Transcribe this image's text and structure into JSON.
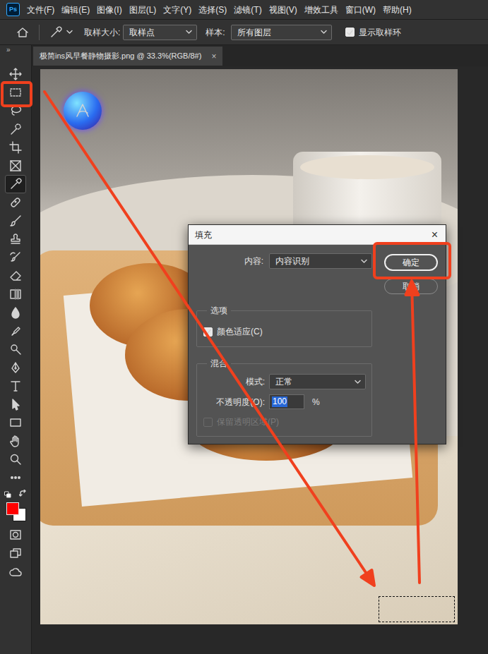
{
  "app": {
    "logo": "Ps"
  },
  "menu": [
    "文件(F)",
    "编辑(E)",
    "图像(I)",
    "图层(L)",
    "文字(Y)",
    "选择(S)",
    "滤镜(T)",
    "视图(V)",
    "增效工具",
    "窗口(W)",
    "帮助(H)"
  ],
  "options_bar": {
    "sample_size_label": "取样大小:",
    "sample_size_value": "取样点",
    "sample_label": "样本:",
    "sample_value": "所有图层",
    "show_ring": {
      "label": "显示取样环",
      "checked": true
    }
  },
  "toolbar": {
    "collapse": "»",
    "tools": [
      {
        "selected": false
      },
      {
        "selected": false
      },
      {
        "selected": false
      },
      {
        "selected": false
      },
      {
        "selected": false
      },
      {
        "selected": false
      },
      {
        "selected": true
      },
      {
        "selected": false
      },
      {
        "selected": false
      },
      {
        "selected": false
      },
      {
        "selected": false
      },
      {
        "selected": false
      },
      {
        "selected": false
      },
      {
        "selected": false
      },
      {
        "selected": false
      },
      {
        "selected": false
      },
      {
        "selected": false
      },
      {
        "selected": false
      },
      {
        "selected": false
      },
      {
        "selected": false
      },
      {
        "selected": false
      },
      {
        "selected": false
      },
      {
        "selected": false
      },
      {
        "selected": false
      },
      {
        "selected": false
      },
      {
        "selected": false
      }
    ],
    "colors": {
      "foreground": "#ff0000",
      "background": "#ffffff"
    }
  },
  "document_tab": {
    "title": "极简ins风早餐静物摄影.png @ 33.3%(RGB/8#)",
    "close": "×"
  },
  "dialog": {
    "title": "填充",
    "close": "×",
    "content_label": "内容:",
    "content_value": "内容识别",
    "buttons": [
      {
        "label": "确定",
        "selected": true
      },
      {
        "label": "取消",
        "selected": false
      }
    ],
    "options": {
      "legend": "选项",
      "color_adapt": {
        "label": "颜色适应(C)",
        "checked": true
      }
    },
    "blend": {
      "legend": "混合",
      "mode_label": "模式:",
      "mode_value": "正常",
      "opacity_label": "不透明度(O):",
      "opacity_value": "100",
      "opacity_unit": "%",
      "preserve": {
        "label": "保留透明区域(P)",
        "checked": false,
        "disabled": true
      }
    }
  }
}
